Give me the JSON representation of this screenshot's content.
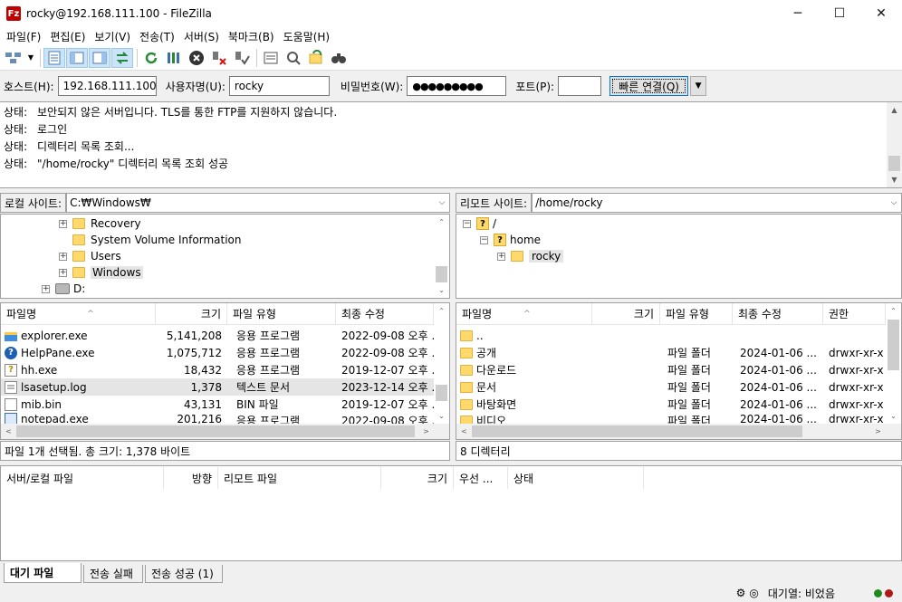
{
  "window": {
    "title": "rocky@192.168.111.100 - FileZilla",
    "app_icon_text": "Fz"
  },
  "menu": [
    "파일(F)",
    "편집(E)",
    "보기(V)",
    "전송(T)",
    "서버(S)",
    "북마크(B)",
    "도움말(H)"
  ],
  "quickconnect": {
    "host_label": "호스트(H):",
    "host_value": "192.168.111.100",
    "user_label": "사용자명(U):",
    "user_value": "rocky",
    "pass_label": "비밀번호(W):",
    "pass_value": "●●●●●●●●●",
    "port_label": "포트(P):",
    "port_value": "",
    "connect_label": "빠른 연결(Q)"
  },
  "messages": [
    {
      "kind": "상태:",
      "text": "보안되지 않은 서버입니다. TLS를 통한 FTP를 지원하지 않습니다."
    },
    {
      "kind": "상태:",
      "text": "로그인"
    },
    {
      "kind": "상태:",
      "text": "디렉터리 목록 조회..."
    },
    {
      "kind": "상태:",
      "text": "\"/home/rocky\" 디렉터리 목록 조회 성공"
    }
  ],
  "local": {
    "site_label": "로컬 사이트:",
    "path": "C:₩Windows₩",
    "tree": [
      "Recovery",
      "System Volume Information",
      "Users",
      "Windows",
      "D:"
    ],
    "headers": {
      "name": "파일명",
      "size": "크기",
      "type": "파일 유형",
      "modified": "최종 수정"
    },
    "files": [
      {
        "name": "explorer.exe",
        "size": "5,141,208",
        "type": "응용 프로그램",
        "modified": "2022-09-08 오후 ..."
      },
      {
        "name": "HelpPane.exe",
        "size": "1,075,712",
        "type": "응용 프로그램",
        "modified": "2022-09-08 오후 ..."
      },
      {
        "name": "hh.exe",
        "size": "18,432",
        "type": "응용 프로그램",
        "modified": "2019-12-07 오후 ..."
      },
      {
        "name": "lsasetup.log",
        "size": "1,378",
        "type": "텍스트 문서",
        "modified": "2023-12-14 오후 ..."
      },
      {
        "name": "mib.bin",
        "size": "43,131",
        "type": "BIN 파일",
        "modified": "2019-12-07 오후 ..."
      },
      {
        "name": "notepad.exe",
        "size": "201,216",
        "type": "응용 프로그램",
        "modified": "2022-09-08 오후 ..."
      }
    ],
    "status": "파일 1개 선택됨. 총 크기: 1,378 바이트"
  },
  "remote": {
    "site_label": "리모트 사이트:",
    "path": "/home/rocky",
    "tree": [
      "/",
      "home",
      "rocky"
    ],
    "headers": {
      "name": "파일명",
      "size": "크기",
      "type": "파일 유형",
      "modified": "최종 수정",
      "perms": "권한"
    },
    "files": [
      {
        "name": "..",
        "type": "",
        "modified": "",
        "perms": ""
      },
      {
        "name": "공개",
        "type": "파일 폴더",
        "modified": "2024-01-06 ...",
        "perms": "drwxr-xr-x"
      },
      {
        "name": "다운로드",
        "type": "파일 폴더",
        "modified": "2024-01-06 ...",
        "perms": "drwxr-xr-x"
      },
      {
        "name": "문서",
        "type": "파일 폴더",
        "modified": "2024-01-06 ...",
        "perms": "drwxr-xr-x"
      },
      {
        "name": "바탕화면",
        "type": "파일 폴더",
        "modified": "2024-01-06 ...",
        "perms": "drwxr-xr-x"
      },
      {
        "name": "비디오",
        "type": "파일 폴더",
        "modified": "2024-01-06 ...",
        "perms": "drwxr-xr-x"
      }
    ],
    "status": "8 디렉터리"
  },
  "queue": {
    "headers": {
      "file": "서버/로컬 파일",
      "direction": "방향",
      "remote": "리모트 파일",
      "size": "크기",
      "priority": "우선 ...",
      "status": "상태"
    },
    "tabs": [
      "대기 파일",
      "전송 실패",
      "전송 성공 (1)"
    ]
  },
  "statusbar": {
    "queue_text": "대기열: 비었음"
  }
}
